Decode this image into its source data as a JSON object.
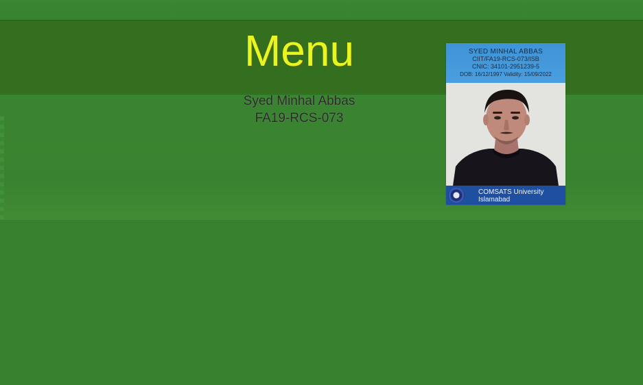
{
  "header": {
    "title": "Menu"
  },
  "student": {
    "name": "Syed Minhal Abbas",
    "reg_no": "FA19-RCS-073"
  },
  "id_card": {
    "name": "SYED MINHAL ABBAS",
    "reg_line": "CIIT/FA19-RCS-073/ISB",
    "cnic_line": "CNIC: 34101-2951239-5",
    "dob_line": "DOB: 16/12/1997   Validity: 15/09/2022",
    "university_line1": "COMSATS University",
    "university_line2": "Islamabad"
  },
  "colors": {
    "background": "#38812f",
    "header_bar": "#336f1f",
    "title": "#e8f51f",
    "card_top": "#4a9fe0",
    "card_bottom": "#1f4fa0"
  },
  "icons": {
    "university_logo": "comsats-logo-icon"
  }
}
